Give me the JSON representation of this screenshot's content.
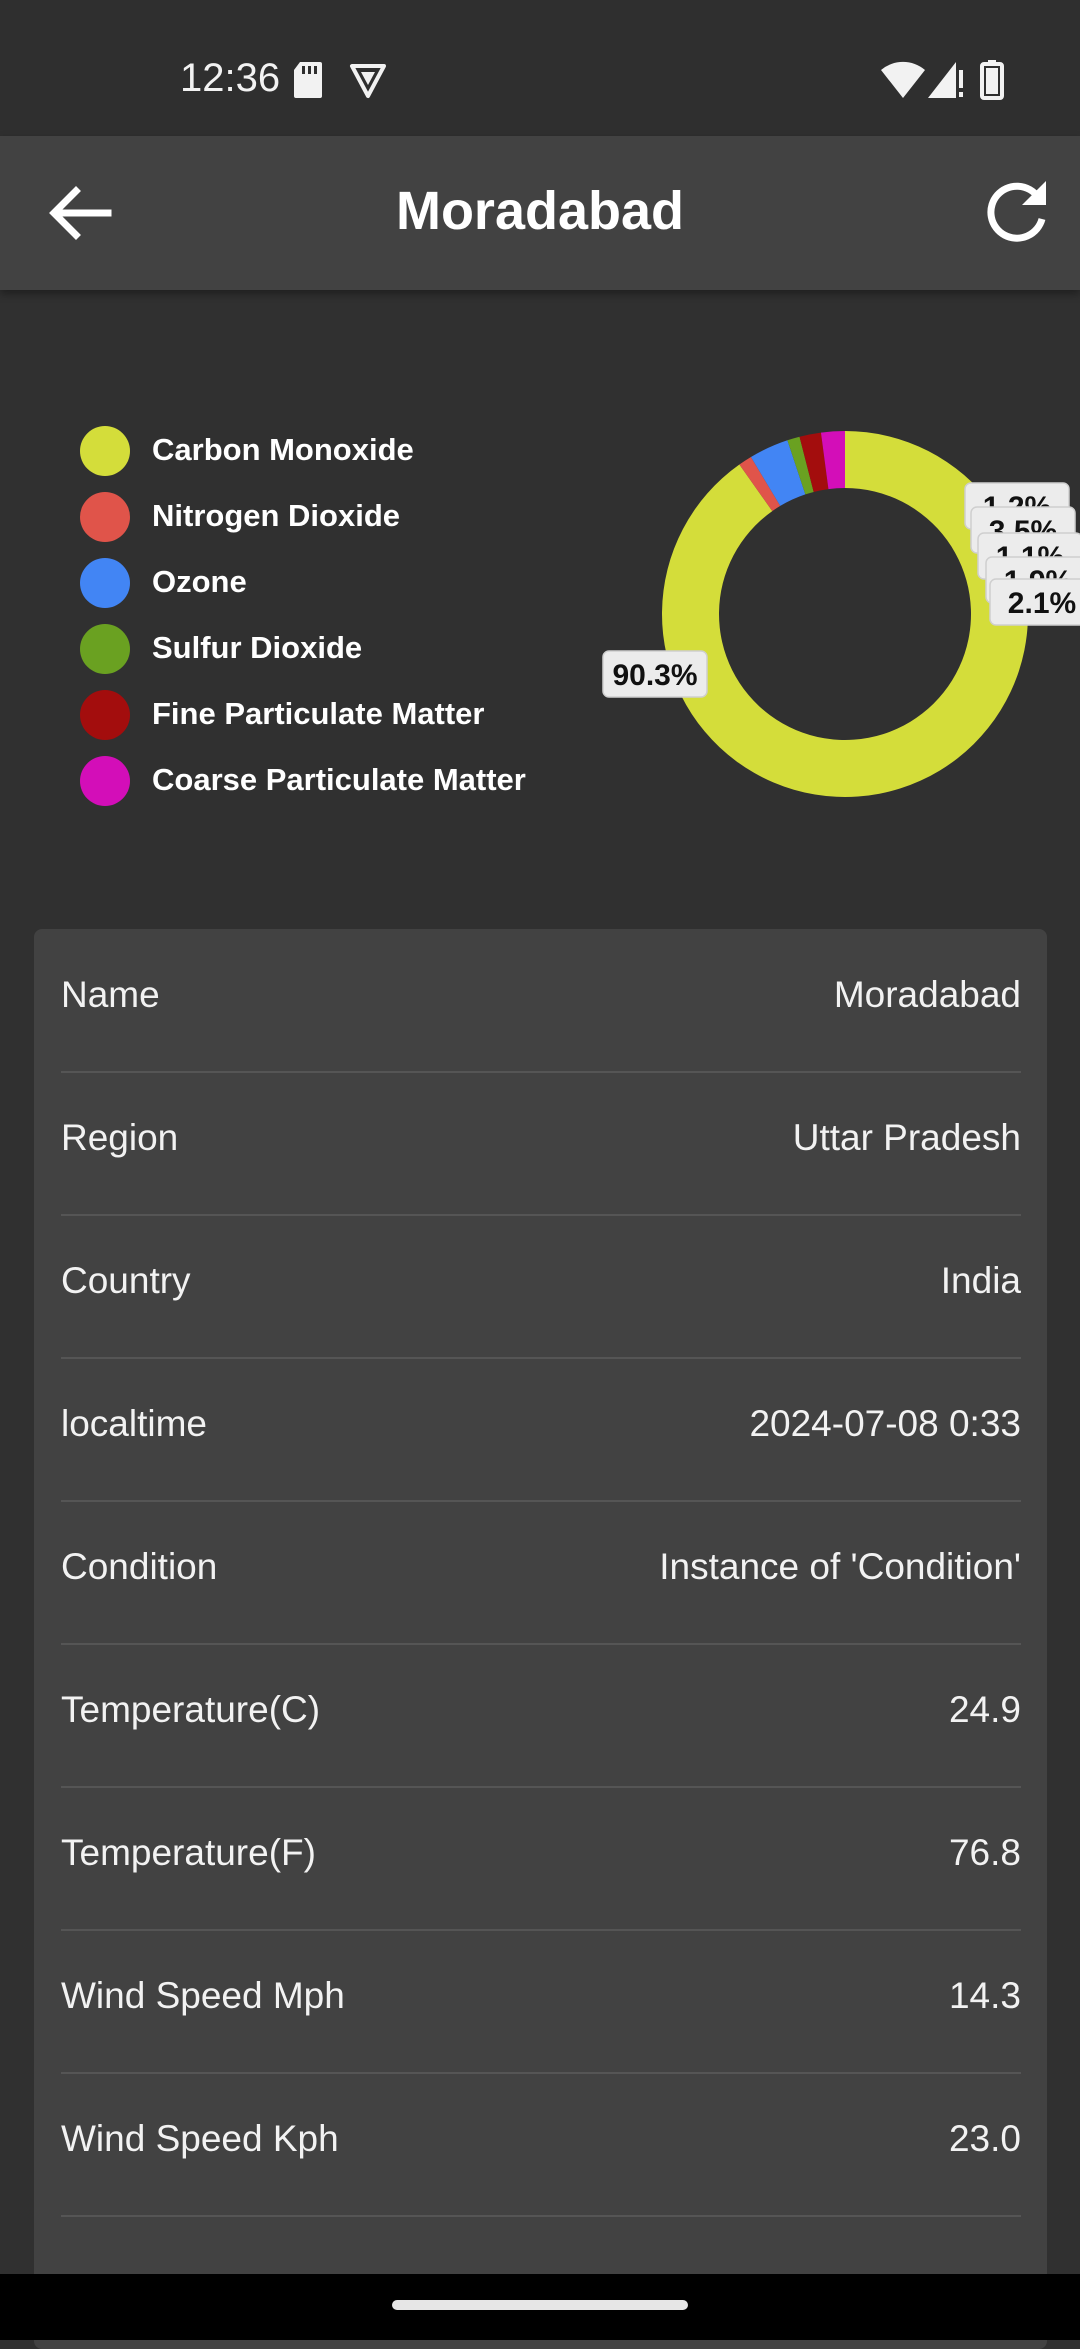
{
  "status_bar": {
    "time": "12:36",
    "icons": [
      "sd-card-icon",
      "vpn-shield-icon",
      "wifi-icon",
      "cell-signal-icon",
      "battery-icon"
    ]
  },
  "app_bar": {
    "title": "Moradabad",
    "back_icon": "arrow-left-icon",
    "refresh_icon": "refresh-icon"
  },
  "chart_data": {
    "type": "pie",
    "donut": true,
    "legend_position": "left",
    "categories": [
      "Carbon Monoxide",
      "Nitrogen Dioxide",
      "Ozone",
      "Sulfur Dioxide",
      "Fine Particulate Matter",
      "Coarse Particulate Matter"
    ],
    "colors": [
      "#d4dd3a",
      "#e0544a",
      "#4285f4",
      "#6aa121",
      "#a30d0d",
      "#d30eb8"
    ],
    "values": [
      90.3,
      1.2,
      3.5,
      1.1,
      1.9,
      2.1
    ],
    "data_labels": [
      "90.3%",
      "1.2%",
      "3.5%",
      "1.1%",
      "1.9%",
      "2.1%"
    ]
  },
  "details": [
    {
      "label": "Name",
      "value": "Moradabad"
    },
    {
      "label": "Region",
      "value": "Uttar Pradesh"
    },
    {
      "label": "Country",
      "value": "India"
    },
    {
      "label": "localtime",
      "value": "2024-07-08 0:33"
    },
    {
      "label": "Condition",
      "value": "Instance of 'Condition'"
    },
    {
      "label": "Temperature(C)",
      "value": "24.9"
    },
    {
      "label": "Temperature(F)",
      "value": "76.8"
    },
    {
      "label": "Wind Speed Mph",
      "value": "14.3"
    },
    {
      "label": "Wind Speed Kph",
      "value": "23.0"
    }
  ]
}
